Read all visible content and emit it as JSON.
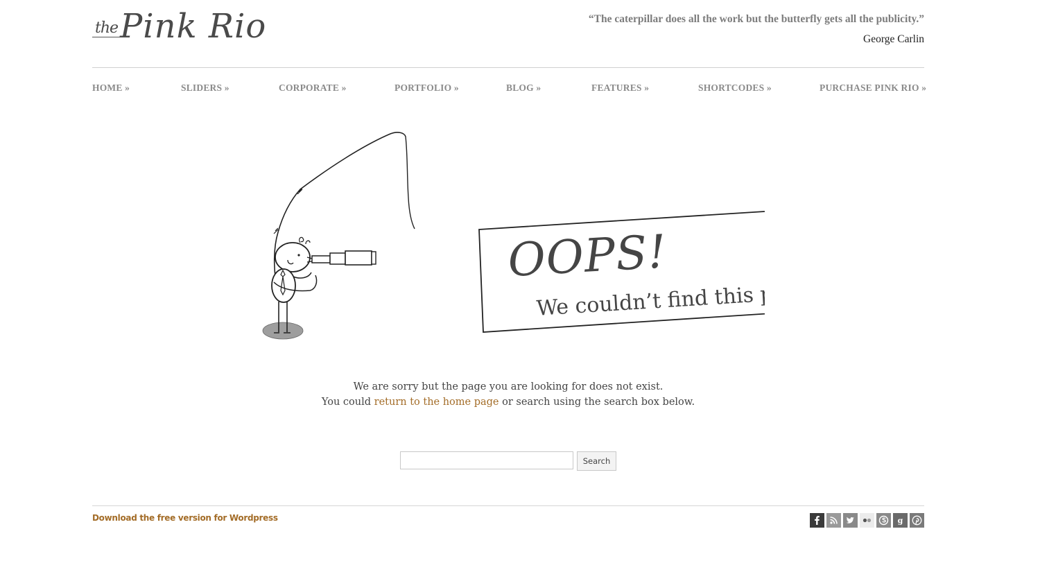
{
  "header": {
    "logo_small": "the",
    "logo_name": "Pink Rio",
    "quote": "“The caterpillar does all the work but the butterfly gets all the publicity.”",
    "author": "George Carlin"
  },
  "nav": {
    "items": [
      {
        "label": "HOME »"
      },
      {
        "label": "SLIDERS »"
      },
      {
        "label": "CORPORATE »"
      },
      {
        "label": "PORTFOLIO »"
      },
      {
        "label": "BLOG »"
      },
      {
        "label": "FEATURES »"
      },
      {
        "label": "SHORTCODES »"
      },
      {
        "label": "PURCHASE PINK RIO »"
      }
    ]
  },
  "illustration": {
    "sign_title": "OOPS!",
    "sign_subtitle": "We couldn’t find this page"
  },
  "message": {
    "line1": "We are sorry but the page you are looking for does not exist.",
    "line2_prefix": "You could ",
    "line2_link": "return to the home page",
    "line2_suffix": " or search using the search box below."
  },
  "search": {
    "placeholder": "",
    "value": "",
    "button_label": "Search"
  },
  "footer": {
    "link_label": "Download the free version for Wordpress",
    "social": [
      {
        "icon": "facebook-icon",
        "color": "#3b3b3b"
      },
      {
        "icon": "rss-icon",
        "color": "#9a9a9a"
      },
      {
        "icon": "twitter-icon",
        "color": "#8a8a8a"
      },
      {
        "icon": "flickr-icon",
        "color": "#ececec"
      },
      {
        "icon": "skype-icon",
        "color": "#8a8a8a"
      },
      {
        "icon": "google-icon",
        "color": "#6a6a6a"
      },
      {
        "icon": "pinterest-icon",
        "color": "#7a7a7a"
      }
    ]
  },
  "colors": {
    "link": "#a36c27",
    "nav_text": "#8a8a8a",
    "quote_text": "#7c7c7c"
  }
}
